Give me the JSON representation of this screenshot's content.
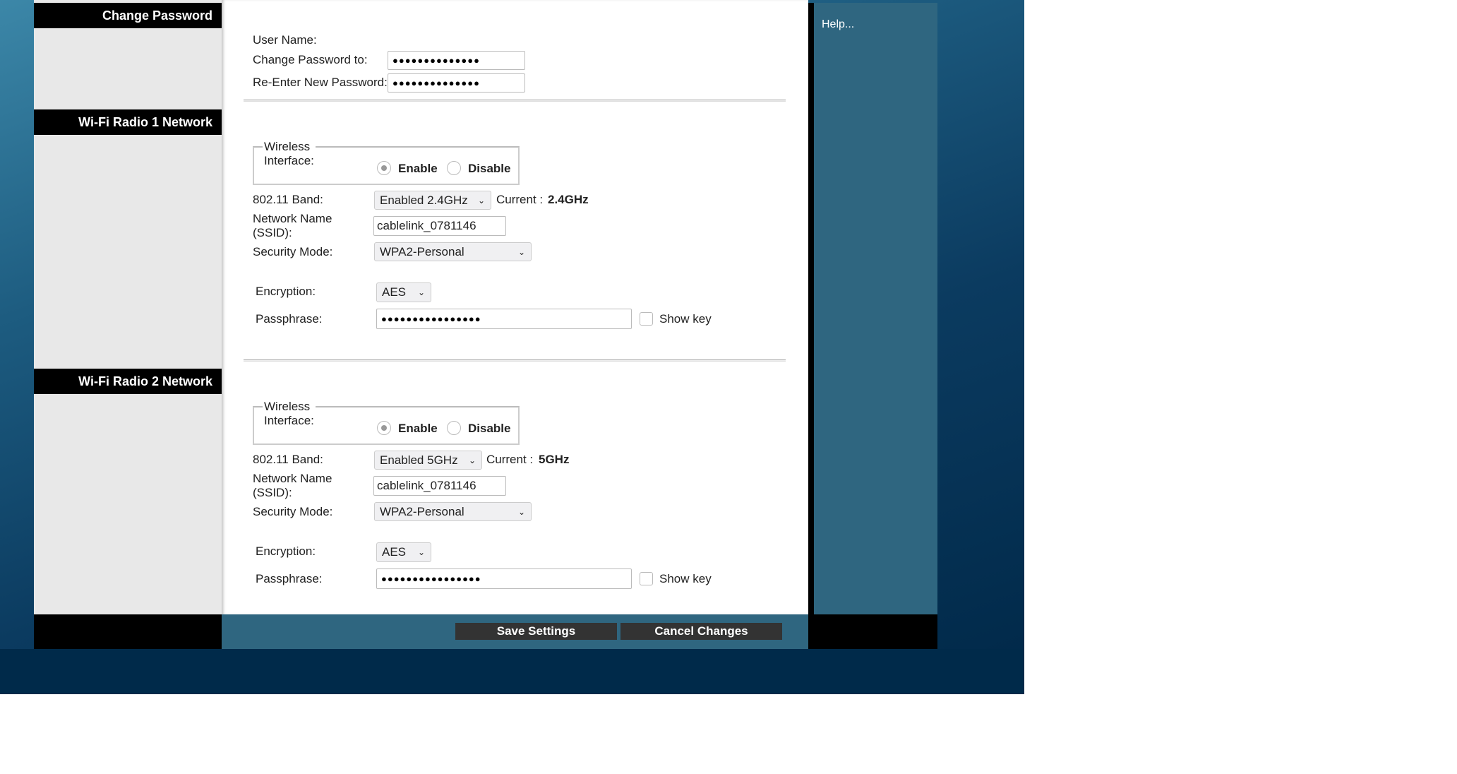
{
  "sidebar": {
    "change_password": "Change Password",
    "radio1": "Wi-Fi Radio 1 Network",
    "radio2": "Wi-Fi Radio 2 Network"
  },
  "help": {
    "label": "Help..."
  },
  "password": {
    "user_name_label": "User Name:",
    "change_label": "Change Password to:",
    "change_value": "●●●●●●●●●●●●●●",
    "reenter_label": "Re-Enter New Password:",
    "reenter_value": "●●●●●●●●●●●●●●"
  },
  "radios": [
    {
      "legend": "Wireless Interface:",
      "enable": "Enable",
      "disable": "Disable",
      "enabled": true,
      "band_label": "802.11 Band:",
      "band_value": "Enabled 2.4GHz",
      "current_label": "Current :",
      "current_value": "2.4GHz",
      "ssid_label1": "Network Name",
      "ssid_label2": "(SSID):",
      "ssid_value": "cablelink_0781146",
      "security_label": "Security Mode:",
      "security_value": "WPA2-Personal",
      "encryption_label": "Encryption:",
      "encryption_value": "AES",
      "passphrase_label": "Passphrase:",
      "passphrase_value": "●●●●●●●●●●●●●●●●",
      "show_key": "Show key"
    },
    {
      "legend": "Wireless Interface:",
      "enable": "Enable",
      "disable": "Disable",
      "enabled": true,
      "band_label": "802.11 Band:",
      "band_value": "Enabled 5GHz",
      "current_label": "Current :",
      "current_value": "5GHz",
      "ssid_label1": "Network Name",
      "ssid_label2": "(SSID):",
      "ssid_value": "cablelink_0781146",
      "security_label": "Security Mode:",
      "security_value": "WPA2-Personal",
      "encryption_label": "Encryption:",
      "encryption_value": "AES",
      "passphrase_label": "Passphrase:",
      "passphrase_value": "●●●●●●●●●●●●●●●●",
      "show_key": "Show key"
    }
  ],
  "footer": {
    "save": "Save Settings",
    "cancel": "Cancel Changes"
  },
  "colors": {
    "panel": "#2f6680",
    "navy": "#002a4a",
    "button": "#333333"
  }
}
